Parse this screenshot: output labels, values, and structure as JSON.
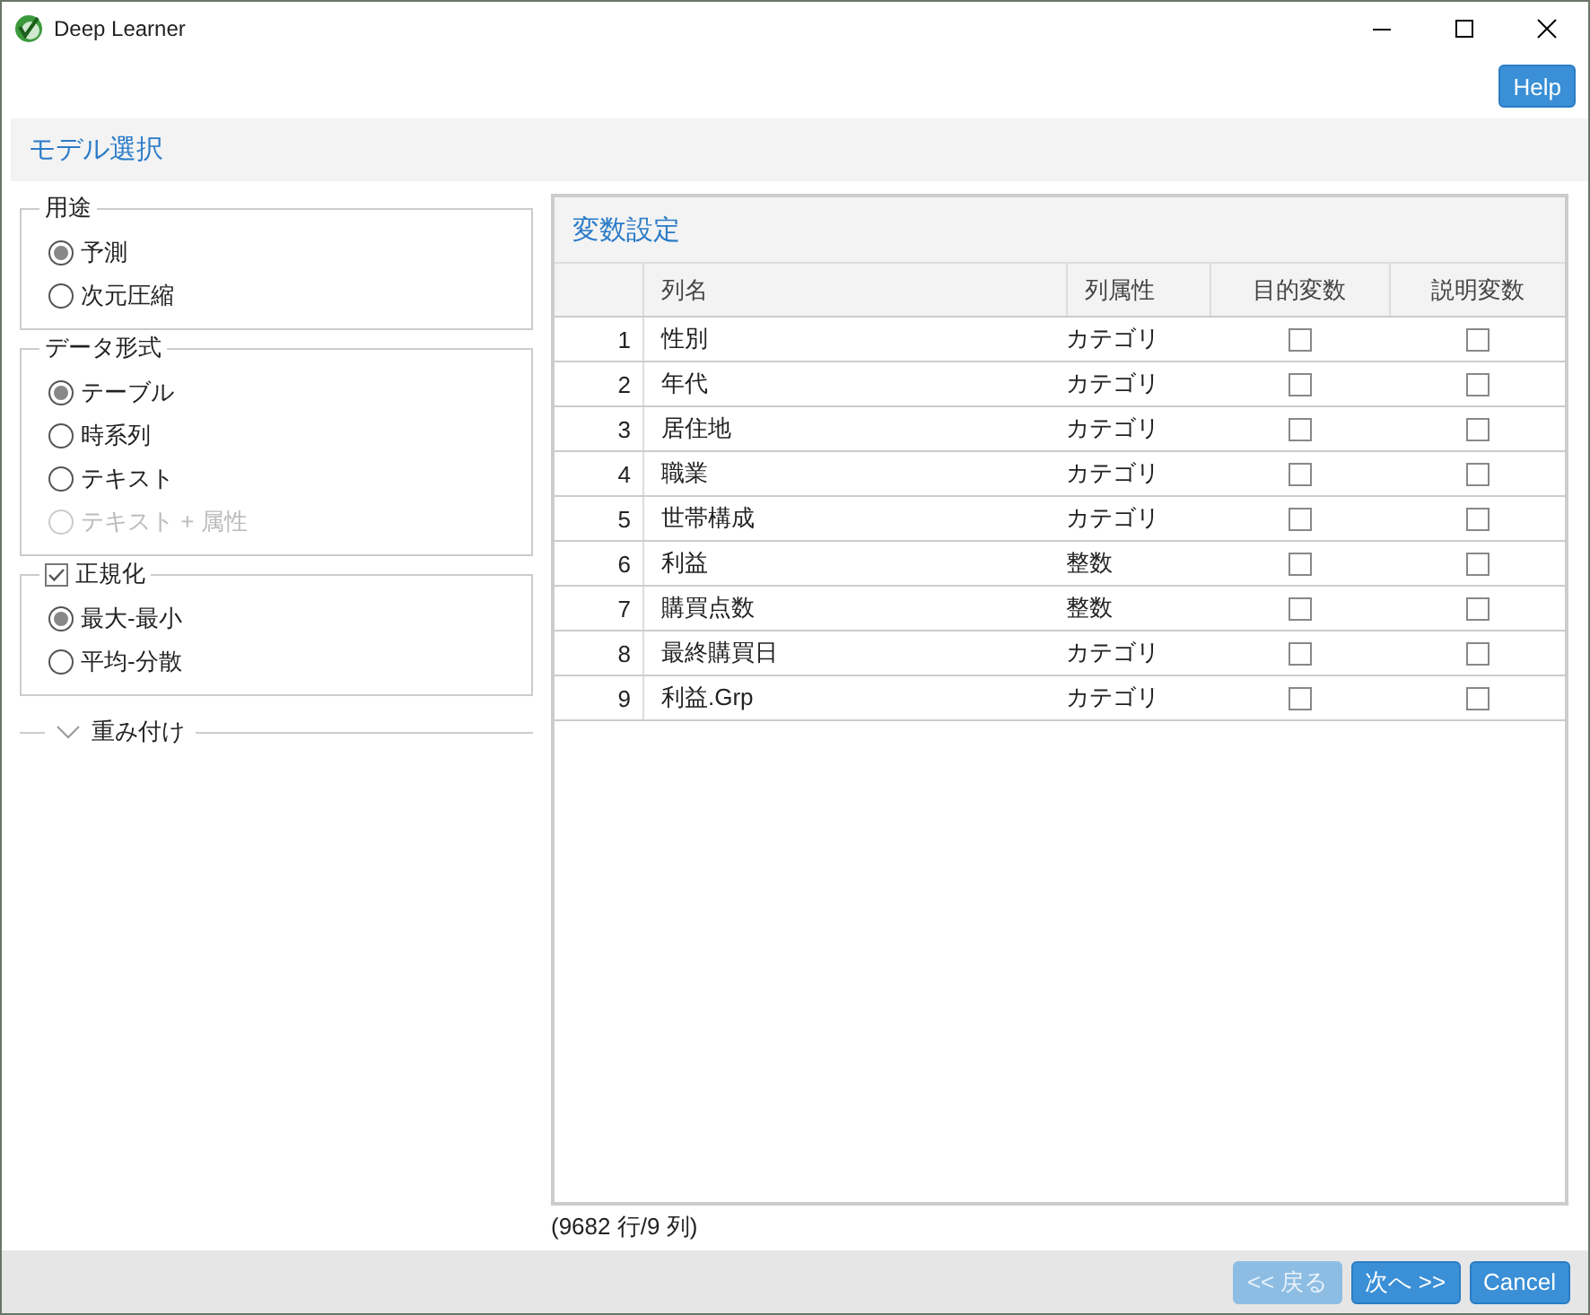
{
  "window": {
    "title": "Deep Learner"
  },
  "help_button": "Help",
  "page_title": "モデル選択",
  "groups": [
    {
      "kind": "radio",
      "legend": "用途",
      "options": [
        {
          "label": "予測",
          "selected": true,
          "disabled": false
        },
        {
          "label": "次元圧縮",
          "selected": false,
          "disabled": false
        }
      ]
    },
    {
      "kind": "radio",
      "legend": "データ形式",
      "options": [
        {
          "label": "テーブル",
          "selected": true,
          "disabled": false
        },
        {
          "label": "時系列",
          "selected": false,
          "disabled": false
        },
        {
          "label": "テキスト",
          "selected": false,
          "disabled": false
        },
        {
          "label": "テキスト + 属性",
          "selected": false,
          "disabled": true
        }
      ]
    },
    {
      "kind": "checkbox",
      "legend": "正規化",
      "checked": true,
      "options": [
        {
          "label": "最大-最小",
          "selected": true,
          "disabled": false
        },
        {
          "label": "平均-分散",
          "selected": false,
          "disabled": false
        }
      ]
    },
    {
      "kind": "collapsible",
      "legend": "重み付け",
      "expanded": false
    }
  ],
  "table": {
    "title": "変数設定",
    "columns": [
      "列名",
      "列属性",
      "目的変数",
      "説明変数"
    ],
    "rows": [
      {
        "index": "1",
        "name": "性別",
        "type": "カテゴリ",
        "target": false,
        "explanatory": false
      },
      {
        "index": "2",
        "name": "年代",
        "type": "カテゴリ",
        "target": false,
        "explanatory": false
      },
      {
        "index": "3",
        "name": "居住地",
        "type": "カテゴリ",
        "target": false,
        "explanatory": false
      },
      {
        "index": "4",
        "name": "職業",
        "type": "カテゴリ",
        "target": false,
        "explanatory": false
      },
      {
        "index": "5",
        "name": "世帯構成",
        "type": "カテゴリ",
        "target": false,
        "explanatory": false
      },
      {
        "index": "6",
        "name": "利益",
        "type": "整数",
        "target": false,
        "explanatory": false
      },
      {
        "index": "7",
        "name": "購買点数",
        "type": "整数",
        "target": false,
        "explanatory": false
      },
      {
        "index": "8",
        "name": "最終購買日",
        "type": "カテゴリ",
        "target": false,
        "explanatory": false
      },
      {
        "index": "9",
        "name": "利益.Grp",
        "type": "カテゴリ",
        "target": false,
        "explanatory": false
      }
    ]
  },
  "footer": "(9682 行/9 列)",
  "buttons": [
    {
      "label": "<< 戻る",
      "disabled": true
    },
    {
      "label": "次へ >>",
      "disabled": false
    },
    {
      "label": "Cancel",
      "disabled": false
    }
  ]
}
